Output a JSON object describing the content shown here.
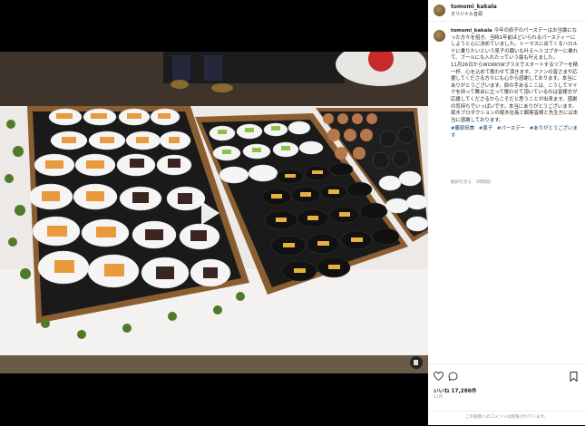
{
  "post": {
    "username": "tomomi_kakala",
    "subtitle": "オリジナル音源",
    "caption_paragraphs": [
      "今年の辰子のパースデーはお当論になった方々を招き、当時1年前ほどいられるパースティーにしようと心に決めていました。トーマスに出てくるハロルドに乗りたいという見子の願いも叶えヘリコプターに乗れて、ブールにも入れたっていう最も叶えました。",
      "11月26日からWOWOWプラスでスタートするツアーを精一杯、心を込めて歌わせて頂きます。ファンの皆さまや応援してくださる方々にも心から感謝しております。本当にありがとうございます。辰の手あるここは、こうしてマイクを持って舞台に立って歌わせて頂いているのは皆様方が応援してくださるからこそだと思うことが出来ます。感謝の気持ちでいっぱいです。本当にありがとうございます。尾木プロダクションの尾木社長と観客皆様と先生方には本当に感謝しております。"
    ],
    "hashtags": [
      "#藤原田美",
      "#恵子",
      "#パースデー",
      "#ありがとうございます"
    ],
    "meta": "翻訳を見る　1時間前",
    "likes": "いいね 17,286件",
    "date": "11月",
    "footer": "この投稿へのコメントは制限されています。"
  },
  "colors": {
    "accent_text": "#262626",
    "muted_text": "#8e8e8e",
    "hashtag": "#00376b",
    "video_bg": "#000000"
  },
  "icons": [
    "play-icon",
    "sound-icon",
    "heart-icon",
    "comment-icon",
    "bookmark-icon"
  ]
}
